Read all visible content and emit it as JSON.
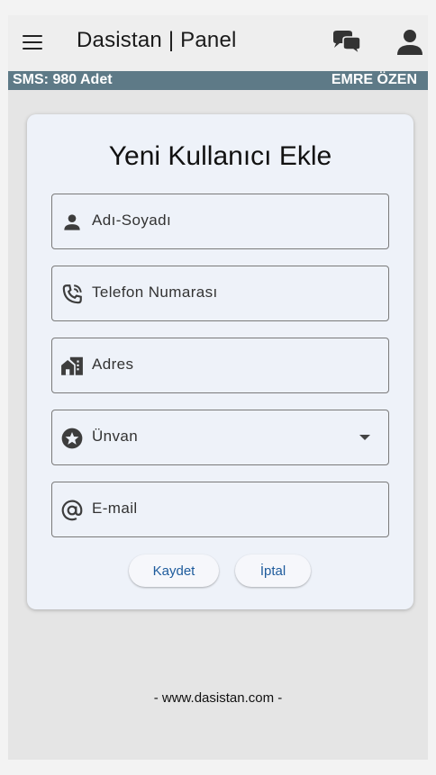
{
  "app": {
    "title": "Dasistan | Panel",
    "menu_icon": "hamburger-menu-icon",
    "chat_icon": "chat-bubbles-icon",
    "profile_icon": "person-icon"
  },
  "status": {
    "sms": "SMS: 980 Adet",
    "user": "EMRE ÖZEN",
    "bar_color": "#5e7a87"
  },
  "form": {
    "title": "Yeni Kullanıcı Ekle",
    "fields": [
      {
        "icon": "person-icon",
        "placeholder": "Adı-Soyadı"
      },
      {
        "icon": "phone-icon",
        "placeholder": "Telefon Numarası"
      },
      {
        "icon": "home-work-icon",
        "placeholder": "Adres"
      },
      {
        "icon": "star-circle-icon",
        "placeholder": "Ünvan",
        "type": "select"
      },
      {
        "icon": "at-sign-icon",
        "placeholder": "E-mail"
      }
    ],
    "save_label": "Kaydet",
    "cancel_label": "İptal",
    "button_text_color": "#1e5b9c"
  },
  "footer": {
    "text": "- www.dasistan.com -"
  }
}
